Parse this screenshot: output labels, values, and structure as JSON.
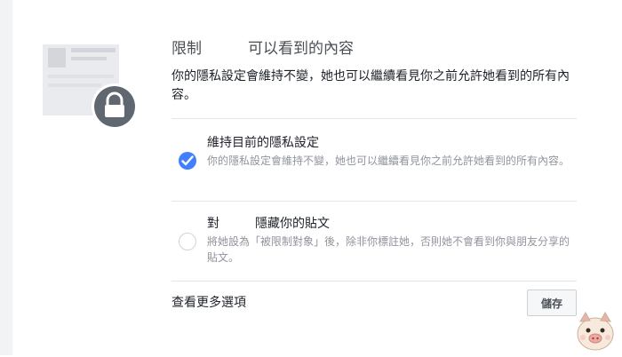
{
  "dialog": {
    "title_prefix": "限制",
    "title_suffix": "可以看到的內容",
    "description": "你的隱私設定會維持不變，她也可以繼續看見你之前允許她看到的所有內容。"
  },
  "options": [
    {
      "title": "維持目前的隱私設定",
      "description": "你的隱私設定會維持不變，她也可以繼續看見你之前允許她看到的所有內容。",
      "selected": true
    },
    {
      "title_prefix": "對",
      "title_suffix": "隱藏你的貼文",
      "description": "將她設為「被限制對象」後，除非你標註她，否則她不會看到你與朋友分享的貼文。",
      "selected": false
    }
  ],
  "footer": {
    "more_options_label": "查看更多選項",
    "save_label": "儲存"
  },
  "colors": {
    "accent": "#4080ff",
    "lock_circle": "#606770",
    "muted_text": "#90949c"
  },
  "icons": {
    "dialog_illustration": "restricted-profile-lock-icon",
    "checked_radio": "checkmark-icon",
    "mascot": "pig-mascot-icon"
  }
}
